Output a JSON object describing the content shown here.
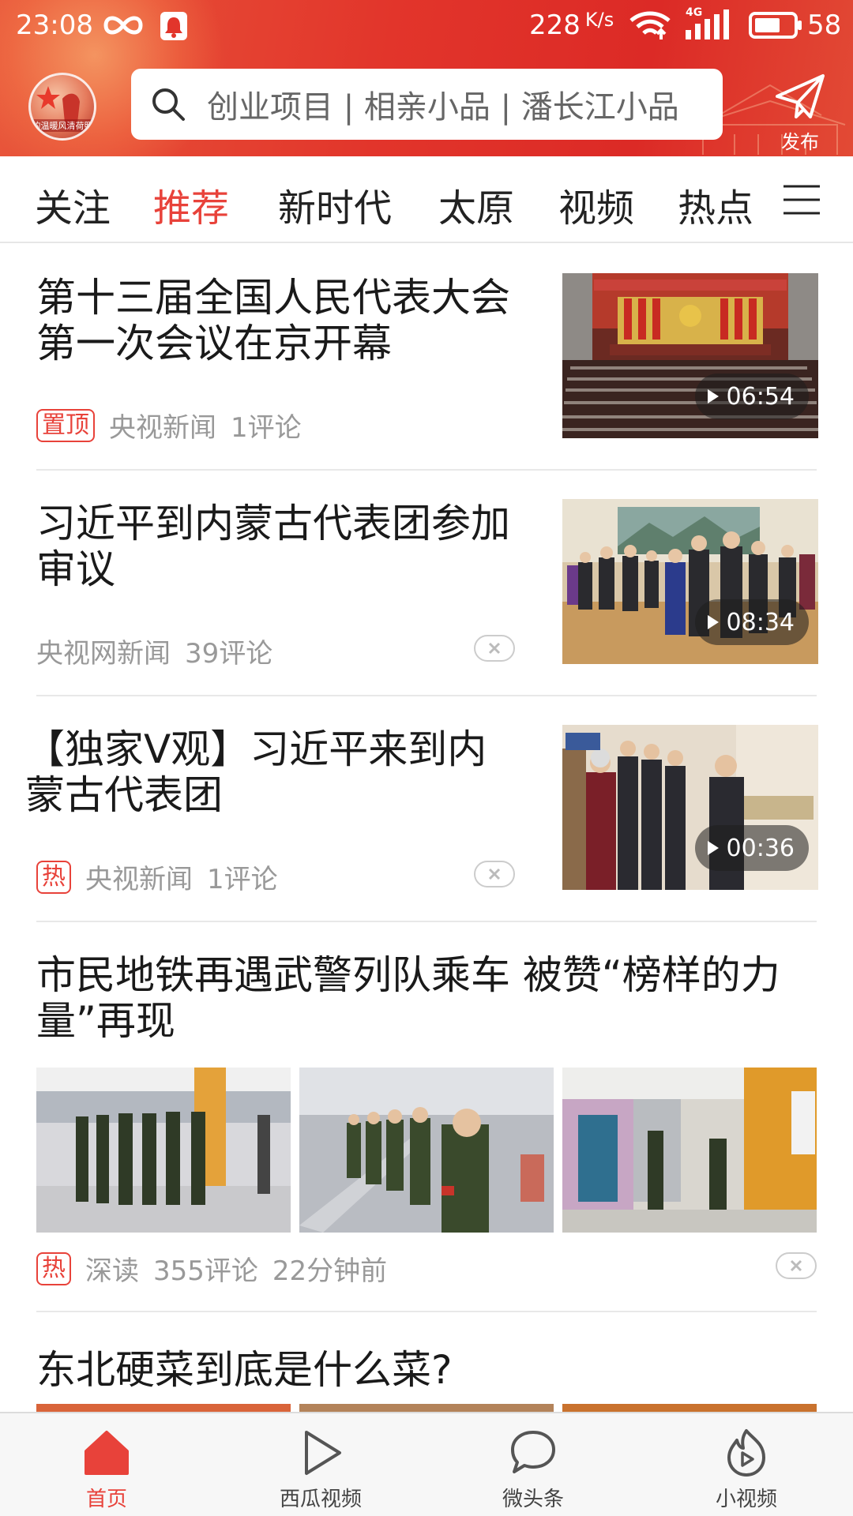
{
  "status_bar": {
    "time": "23:08",
    "speed": "228",
    "speed_unit": "K/s",
    "network": "4G",
    "battery": "58"
  },
  "header": {
    "avatar_caption": "的温暖风清荷照",
    "search_placeholder": "创业项目 | 相亲小品 | 潘长江小品",
    "publish_label": "发布",
    "accent_color": "#e2352b"
  },
  "tabs": [
    {
      "label": "关注",
      "active": false
    },
    {
      "label": "推荐",
      "active": true
    },
    {
      "label": "新时代",
      "active": false
    },
    {
      "label": "太原",
      "active": false
    },
    {
      "label": "视频",
      "active": false
    },
    {
      "label": "热点",
      "active": false
    }
  ],
  "feed": [
    {
      "title": "第十三届全国人民代表大会第一次会议在京开幕",
      "tag": "置顶",
      "source": "央视新闻",
      "comments": "1评论",
      "duration": "06:54",
      "dismissible": false
    },
    {
      "title": "习近平到内蒙古代表团参加审议",
      "tag": "",
      "source": "央视网新闻",
      "comments": "39评论",
      "duration": "08:34",
      "dismissible": true
    },
    {
      "title": "【独家V观】习近平来到内蒙古代表团",
      "tag": "热",
      "source": "央视新闻",
      "comments": "1评论",
      "duration": "00:36",
      "dismissible": true
    },
    {
      "title": "市民地铁再遇武警列队乘车 被赞“榜样的力量”再现",
      "tag": "热",
      "source": "深读",
      "comments": "355评论",
      "time": "22分钟前",
      "dismissible": true
    },
    {
      "title": "东北硬菜到底是什么菜?"
    }
  ],
  "bottom_nav": [
    {
      "label": "首页",
      "icon": "home-icon",
      "active": true
    },
    {
      "label": "西瓜视频",
      "icon": "play-icon",
      "active": false
    },
    {
      "label": "微头条",
      "icon": "chat-bubble-icon",
      "active": false
    },
    {
      "label": "小视频",
      "icon": "flame-play-icon",
      "active": false
    }
  ]
}
